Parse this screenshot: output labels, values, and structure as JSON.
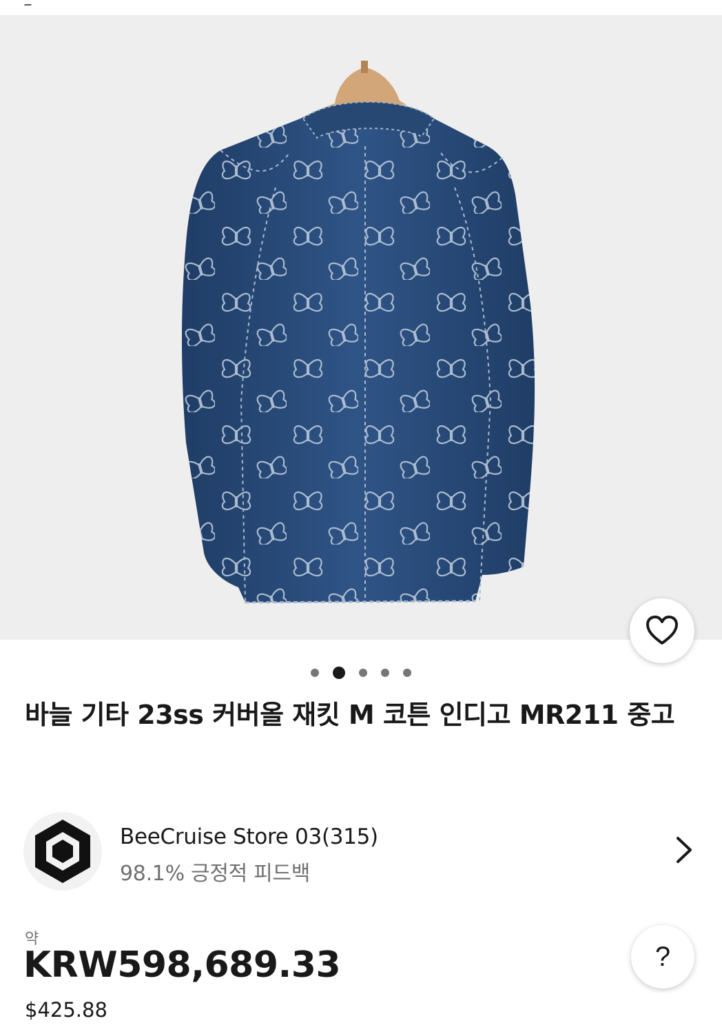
{
  "product": {
    "image_alt": "product-photo-denim-jacket-back",
    "title": "바늘 기타 23ss 커버올 재킷 M 코튼 인디고 MR211 중고",
    "gallery": {
      "total": 5,
      "active_index": 1
    }
  },
  "seller": {
    "name": "BeeCruise Store 03(315)",
    "feedback": "98.1% 긍정적 피드백"
  },
  "price": {
    "approx_label": "약",
    "main": "KRW598,689.33",
    "usd": "$425.88"
  },
  "help": {
    "label": "?"
  },
  "icons": {
    "favorite": "heart-icon",
    "seller_nav": "chevron-right-icon",
    "seller_logo": "hexagon-logo-icon"
  },
  "colors": {
    "denim": "#2d4f7e",
    "background": "#eeeeee",
    "text": "#191919",
    "muted": "#707070"
  }
}
